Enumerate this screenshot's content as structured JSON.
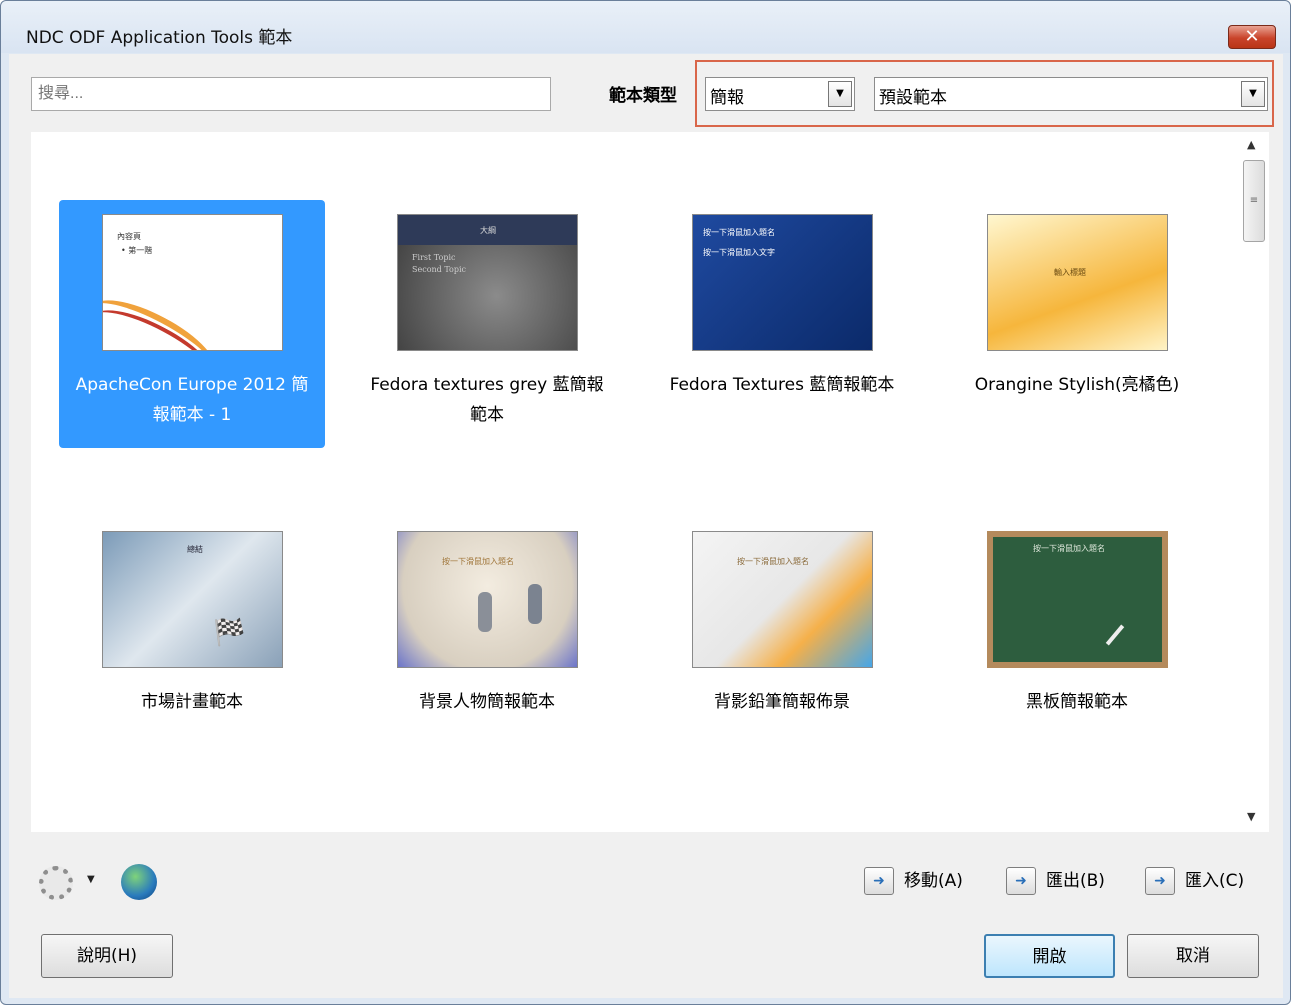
{
  "window": {
    "title": "NDC ODF Application Tools 範本",
    "close_symbol": "✕"
  },
  "search": {
    "placeholder": "搜尋..."
  },
  "filter": {
    "label": "範本類型",
    "type_selected": "簡報",
    "category_selected": "預設範本"
  },
  "templates": [
    {
      "label": "ApacheCon Europe 2012 簡報範本 - 1",
      "selected": true
    },
    {
      "label": "Fedora textures grey 藍簡報範本",
      "selected": false
    },
    {
      "label": "Fedora Textures 藍簡報範本",
      "selected": false
    },
    {
      "label": "Orangine Stylish(亮橘色)",
      "selected": false
    },
    {
      "label": "市場計畫範本",
      "selected": false
    },
    {
      "label": "背景人物簡報範本",
      "selected": false
    },
    {
      "label": "背影鉛筆簡報佈景",
      "selected": false
    },
    {
      "label": "黑板簡報範本",
      "selected": false
    }
  ],
  "actions": {
    "move": "移動(A)",
    "export": "匯出(B)",
    "import": "匯入(C)"
  },
  "buttons": {
    "help": "說明(H)",
    "open": "開啟",
    "cancel": "取消"
  },
  "colors": {
    "selection": "#3399ff",
    "highlight_border": "#d9664a"
  }
}
